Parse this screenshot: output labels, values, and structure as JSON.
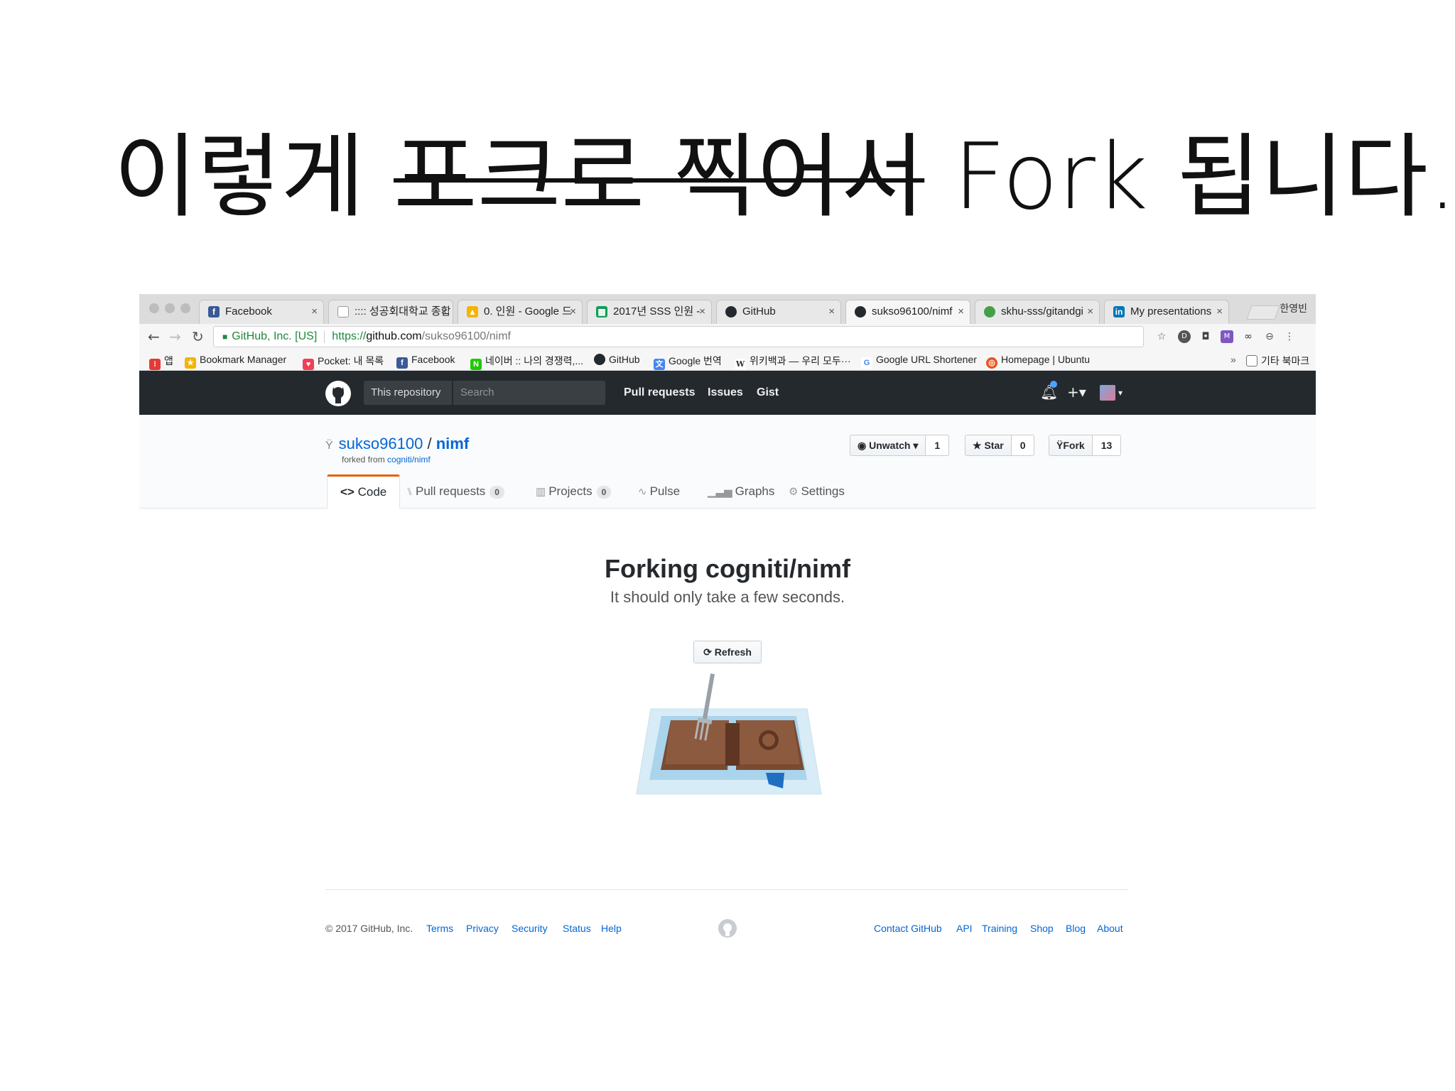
{
  "slide": {
    "title_pre": "이렇게 ",
    "title_strike": "포크로 찍어서",
    "title_post": " Fork 됩니다."
  },
  "browser": {
    "tabs": [
      {
        "label": "Facebook",
        "icon": "facebook-icon",
        "color": "#3b5998"
      },
      {
        "label": ":::: 성공회대학교 종합",
        "icon": "page-icon",
        "color": "#999999"
      },
      {
        "label": "0. 인원 - Google 드",
        "icon": "google-drive-icon",
        "color": "#f4b400"
      },
      {
        "label": "2017년 SSS 인원 -",
        "icon": "google-sheets-icon",
        "color": "#0f9d58"
      },
      {
        "label": "GitHub",
        "icon": "github-icon",
        "color": "#24292e"
      },
      {
        "label": "sukso96100/nimf",
        "icon": "github-icon",
        "color": "#24292e"
      },
      {
        "label": "skhu-sss/gitandgi",
        "icon": "gitbook-icon",
        "color": "#43a047"
      },
      {
        "label": "My presentations",
        "icon": "linkedin-icon",
        "color": "#0077b5"
      }
    ],
    "profile_name": "한영빈",
    "address": {
      "org": "GitHub, Inc. [US]",
      "scheme": "https://",
      "host": "github.com",
      "path": "/sukso96100/nimf"
    },
    "bookmarks": [
      {
        "label": "앱",
        "icon": "apps-icon",
        "color": "#e53935"
      },
      {
        "label": "Bookmark Manager",
        "icon": "star-icon",
        "color": "#f4b400"
      },
      {
        "label": "Pocket: 내 목록",
        "icon": "pocket-icon",
        "color": "#ef4056"
      },
      {
        "label": "Facebook",
        "icon": "facebook-icon",
        "color": "#3b5998"
      },
      {
        "label": "네이버 :: 나의 경쟁력,...",
        "icon": "naver-icon",
        "color": "#1ec800"
      },
      {
        "label": "GitHub",
        "icon": "github-icon",
        "color": "#24292e"
      },
      {
        "label": "Google 번역",
        "icon": "google-translate-icon",
        "color": "#4285f4"
      },
      {
        "label": "위키백과 — 우리 모두···",
        "icon": "wikipedia-icon",
        "color": "#555555"
      },
      {
        "label": "Google URL Shortener",
        "icon": "google-icon",
        "color": "#4285f4"
      },
      {
        "label": "Homepage | Ubuntu",
        "icon": "ubuntu-icon",
        "color": "#e95420"
      }
    ],
    "other_bookmarks": "기타 북마크",
    "overflow": "»"
  },
  "github": {
    "scope_label": "This repository",
    "search_placeholder": "Search",
    "nav": [
      "Pull requests",
      "Issues",
      "Gist"
    ],
    "owner": "sukso96100",
    "slash": "/",
    "repo": "nimf",
    "forked_from_prefix": "forked from ",
    "forked_from": "cogniti/nimf",
    "unwatch_label": "Unwatch ▾",
    "watch_count": "1",
    "star_label": "Star",
    "star_count": "0",
    "fork_label": "Fork",
    "fork_count": "13",
    "tabs": {
      "code": "Code",
      "pull_requests": "Pull requests",
      "pull_requests_count": "0",
      "projects": "Projects",
      "projects_count": "0",
      "pulse": "Pulse",
      "graphs": "Graphs",
      "settings": "Settings"
    },
    "forking_title": "Forking cogniti/nimf",
    "forking_sub": "It should only take a few seconds.",
    "refresh_label": "Refresh",
    "footer": {
      "copyright": "© 2017 GitHub, Inc.",
      "left_links": [
        "Terms",
        "Privacy",
        "Security",
        "Status",
        "Help"
      ],
      "right_links": [
        "Contact GitHub",
        "API",
        "Training",
        "Shop",
        "Blog",
        "About"
      ]
    }
  }
}
